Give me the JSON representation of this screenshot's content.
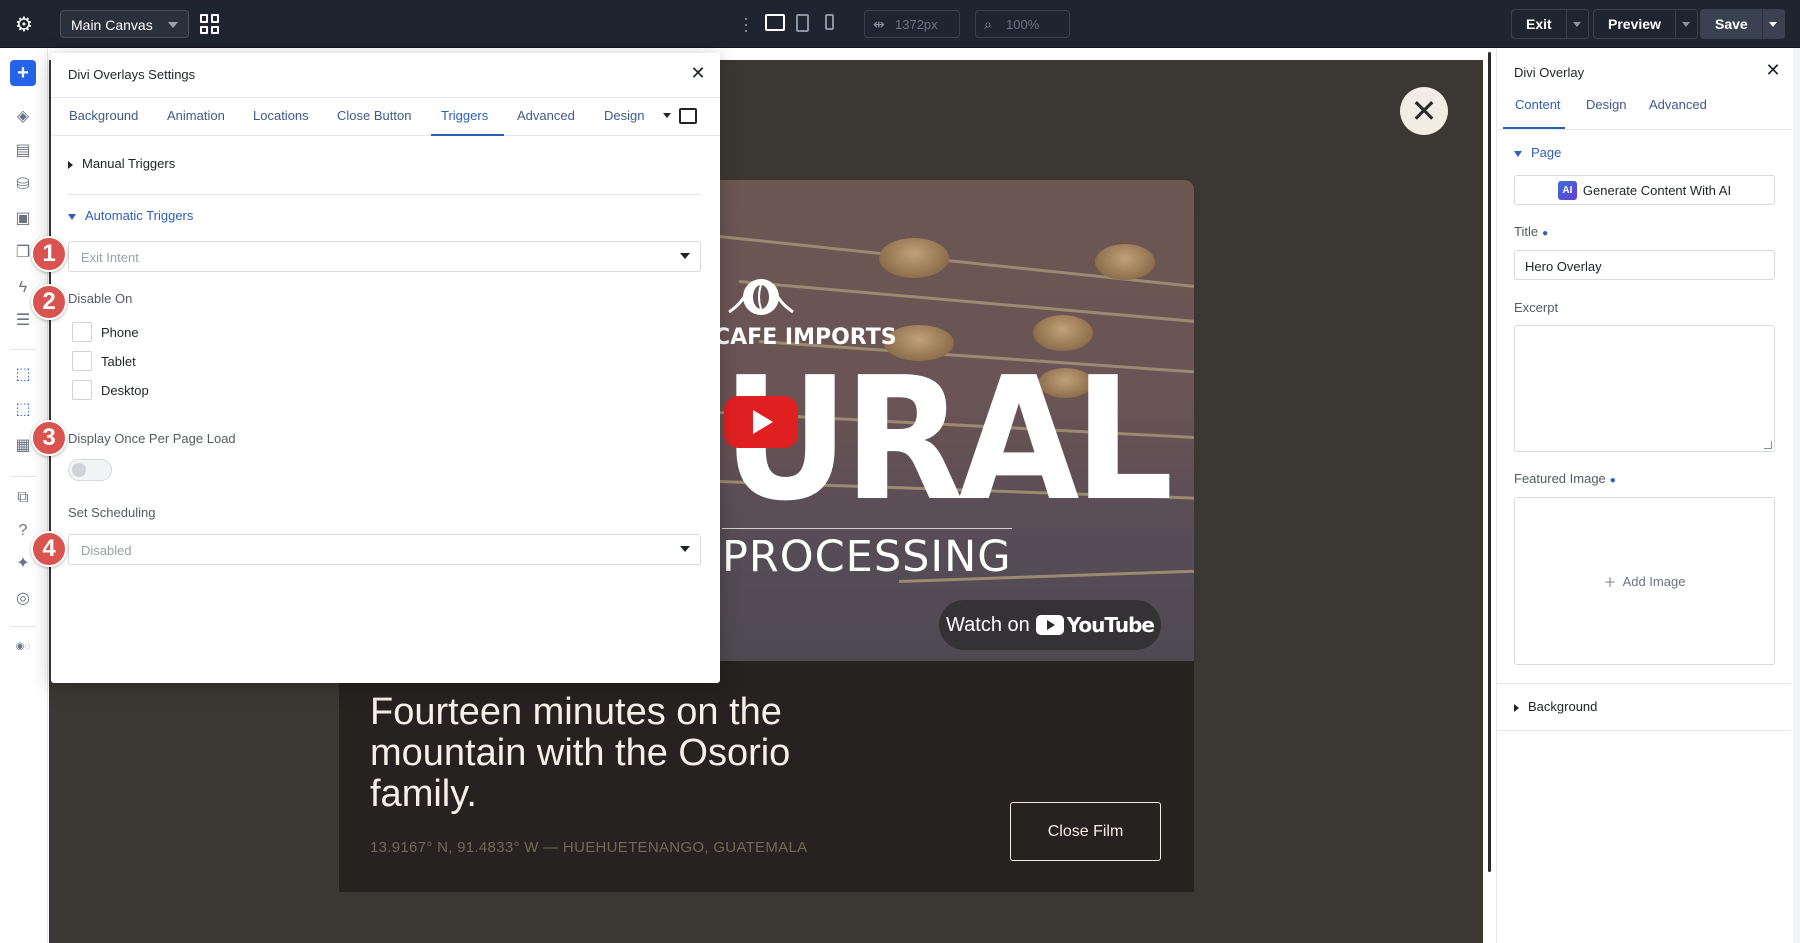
{
  "topbar": {
    "canvas_select": "Main Canvas",
    "width_readout": "1372px",
    "zoom_readout": "100%",
    "exit_label": "Exit",
    "preview_label": "Preview",
    "save_label": "Save"
  },
  "modal": {
    "title": "Divi Overlays Settings",
    "tabs": [
      "Background",
      "Animation",
      "Locations",
      "Close Button",
      "Triggers",
      "Advanced",
      "Design"
    ],
    "active_tab": "Triggers",
    "manual_triggers": "Manual Triggers",
    "automatic_triggers": "Automatic Triggers",
    "trigger_select": {
      "value": "Exit Intent"
    },
    "disable_on_label": "Disable On",
    "disable_on_options": [
      "Phone",
      "Tablet",
      "Desktop"
    ],
    "display_once_label": "Display Once Per Page Load",
    "display_once_enabled": false,
    "scheduling_label": "Set Scheduling",
    "scheduling_select": {
      "value": "Disabled"
    }
  },
  "markers": [
    "1",
    "2",
    "3",
    "4"
  ],
  "canvas": {
    "video": {
      "brand_text": "CAFE IMPORTS",
      "big_text": "URAL",
      "sub_text": "PROCESSING",
      "youtube_watch": "Watch on",
      "youtube_brand": "YouTube"
    },
    "headline": "Fourteen minutes on the mountain with the Osorio family.",
    "coords": "13.9167° N, 91.4833° W — HUEHUETENANGO, GUATEMALA",
    "close_film_label": "Close Film"
  },
  "right_panel": {
    "title": "Divi Overlay",
    "tabs": [
      "Content",
      "Design",
      "Advanced"
    ],
    "active_tab": "Content",
    "page_section": "Page",
    "ai_button": "Generate Content With AI",
    "ai_badge": "AI",
    "title_label": "Title",
    "title_value": "Hero Overlay",
    "excerpt_label": "Excerpt",
    "featured_image_label": "Featured Image",
    "add_image_label": "Add Image",
    "background_section": "Background"
  },
  "colors": {
    "topbar_bg": "#1e2430",
    "accent": "#2b5fb8",
    "canvas_bg": "#3b3834",
    "marker": "#d9534f",
    "rail_add": "#2563eb"
  }
}
